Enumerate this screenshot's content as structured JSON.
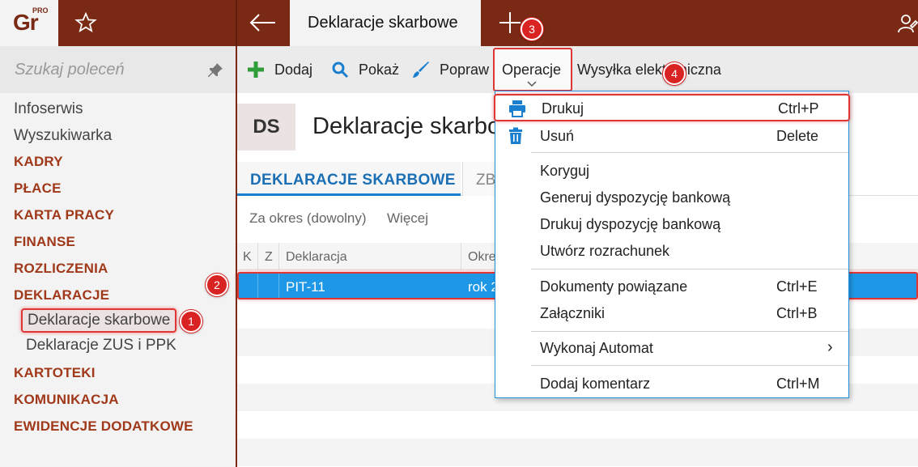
{
  "app": {
    "logo_text": "Gr",
    "logo_badge": "PRO"
  },
  "top_tab": {
    "title": "Deklaracje skarbowe"
  },
  "sidebar": {
    "search_placeholder": "Szukaj poleceń",
    "plain_items": [
      "Infoserwis",
      "Wyszukiwarka"
    ],
    "sections": [
      "KADRY",
      "PŁACE",
      "KARTA PRACY",
      "FINANSE",
      "ROZLICZENIA",
      "DEKLARACJE"
    ],
    "sub_items": [
      "Deklaracje skarbowe",
      "Deklaracje ZUS i PPK"
    ],
    "sections_after": [
      "KARTOTEKI",
      "KOMUNIKACJA",
      "EWIDENCJE DODATKOWE"
    ]
  },
  "toolbar": {
    "add": "Dodaj",
    "show": "Pokaż",
    "edit": "Popraw",
    "operations": "Operacje",
    "eshipping": "Wysyłka elektroniczna"
  },
  "page": {
    "tile": "DS",
    "title": "Deklaracje skarbowe"
  },
  "tabs": {
    "active": "DEKLARACJE SKARBOWE",
    "other_partial": "ZB"
  },
  "filters": {
    "period": "Za okres (dowolny)",
    "more": "Więcej"
  },
  "grid": {
    "headers": [
      "K",
      "Z",
      "Deklaracja",
      "Okres"
    ],
    "selected_row": {
      "declaration": "PIT-11",
      "period": "rok 2"
    }
  },
  "menu": {
    "items": [
      {
        "label": "Drukuj",
        "shortcut": "Ctrl+P",
        "icon": "printer-icon"
      },
      {
        "label": "Usuń",
        "shortcut": "Delete",
        "icon": "trash-icon"
      },
      {
        "label": "Koryguj",
        "shortcut": ""
      },
      {
        "label": "Generuj dyspozycję bankową",
        "shortcut": ""
      },
      {
        "label": "Drukuj dyspozycję bankową",
        "shortcut": ""
      },
      {
        "label": "Utwórz rozrachunek",
        "shortcut": ""
      },
      {
        "label": "Dokumenty powiązane",
        "shortcut": "Ctrl+E"
      },
      {
        "label": "Załączniki",
        "shortcut": "Ctrl+B"
      },
      {
        "label": "Wykonaj Automat",
        "shortcut": "",
        "submenu_arrow": "›"
      },
      {
        "label": "Dodaj komentarz",
        "shortcut": "Ctrl+M"
      }
    ]
  },
  "badges": [
    "1",
    "2",
    "3",
    "4"
  ],
  "colors": {
    "brand": "#7a2a14",
    "accent": "#1e98e6",
    "highlight": "#e03535",
    "section": "#a0381a"
  }
}
